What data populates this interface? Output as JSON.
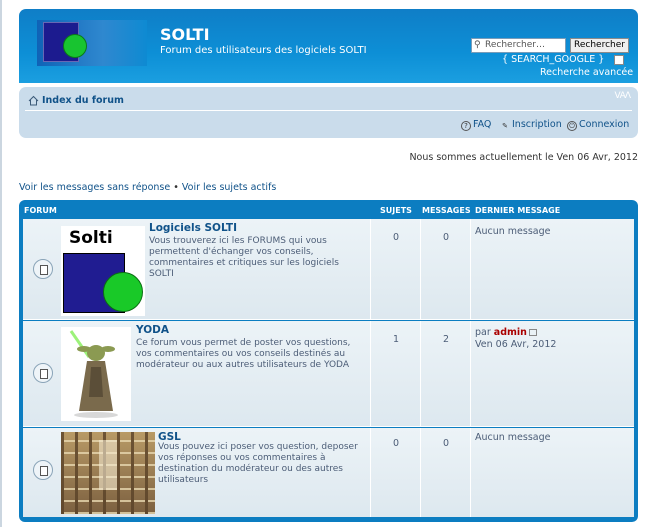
{
  "header": {
    "title": "SOLTI",
    "description": "Forum des utilisateurs des logiciels SOLTI",
    "search_placeholder": "Rechercher…",
    "search_button": "Rechercher",
    "search_google": "{ SEARCH_GOOGLE }",
    "advanced_search": "Recherche avancée"
  },
  "navbar": {
    "breadcrumb": "Index du forum",
    "font_size_control": "ᐯAᐱ",
    "faq": "FAQ",
    "register": "Inscription",
    "login": "Connexion"
  },
  "date_line": "Nous sommes actuellement le Ven 06 Avr, 2012",
  "links": {
    "unanswered": "Voir les messages sans réponse",
    "separator": " • ",
    "active": "Voir les sujets actifs"
  },
  "table": {
    "headers": {
      "forum": "FORUM",
      "topics": "SUJETS",
      "posts": "MESSAGES",
      "last_post": "DERNIER MESSAGE"
    },
    "rows": [
      {
        "title": "Logiciels SOLTI",
        "description": "Vous trouverez ici les FORUMS qui vous permettent d'échanger vos conseils, commentaires et critiques sur les logiciels SOLTI",
        "image_text": "Solti",
        "topics": "0",
        "posts": "0",
        "last_post": "Aucun message"
      },
      {
        "title": "YODA",
        "description": "Ce forum vous permet de poster vos questions, vos commentaires ou vos conseils destinés au modérateur ou aux autres utilisateurs de YODA",
        "topics": "1",
        "posts": "2",
        "last_post_by": "par",
        "last_post_author": "admin",
        "last_post_date": "Ven 06 Avr, 2012"
      },
      {
        "title": "GSL",
        "description": "Vous pouvez ici poser vos question, deposer vos réponses ou vos commentaires à destination du modérateur ou des autres utilisateurs",
        "topics": "0",
        "posts": "0",
        "last_post": "Aucun message"
      }
    ]
  },
  "colors": {
    "header_blue": "#0d8fd6",
    "navbar_bg": "#cadceb",
    "link": "#105289",
    "author": "#aa0000"
  }
}
